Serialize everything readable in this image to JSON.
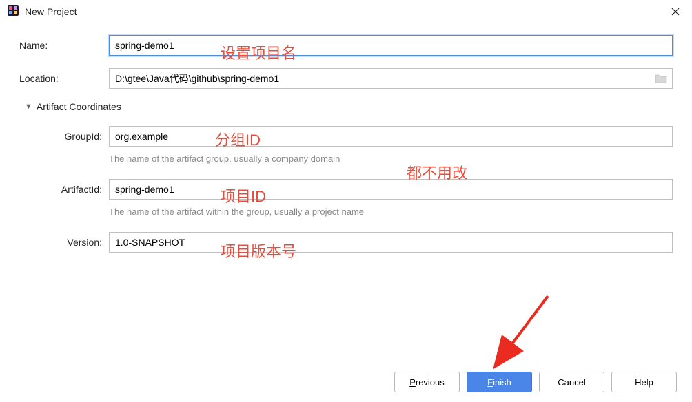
{
  "window": {
    "title": "New Project"
  },
  "form": {
    "name_label": "Name:",
    "name_value": "spring-demo1",
    "location_label": "Location:",
    "location_value": "D:\\gtee\\Java代码\\github\\spring-demo1"
  },
  "artifact": {
    "section_title": "Artifact Coordinates",
    "groupid_label": "GroupId:",
    "groupid_value": "org.example",
    "groupid_help": "The name of the artifact group, usually a company domain",
    "artifactid_label": "ArtifactId:",
    "artifactid_value": "spring-demo1",
    "artifactid_help": "The name of the artifact within the group, usually a project name",
    "version_label": "Version:",
    "version_value": "1.0-SNAPSHOT"
  },
  "annotations": {
    "name": "设置项目名",
    "groupid": "分组ID",
    "nochange": "都不用改",
    "artifactid": "项目ID",
    "version": "项目版本号"
  },
  "buttons": {
    "previous": "Previous",
    "previous_key": "P",
    "finish": "Finish",
    "finish_key": "F",
    "cancel": "Cancel",
    "help": "Help"
  }
}
